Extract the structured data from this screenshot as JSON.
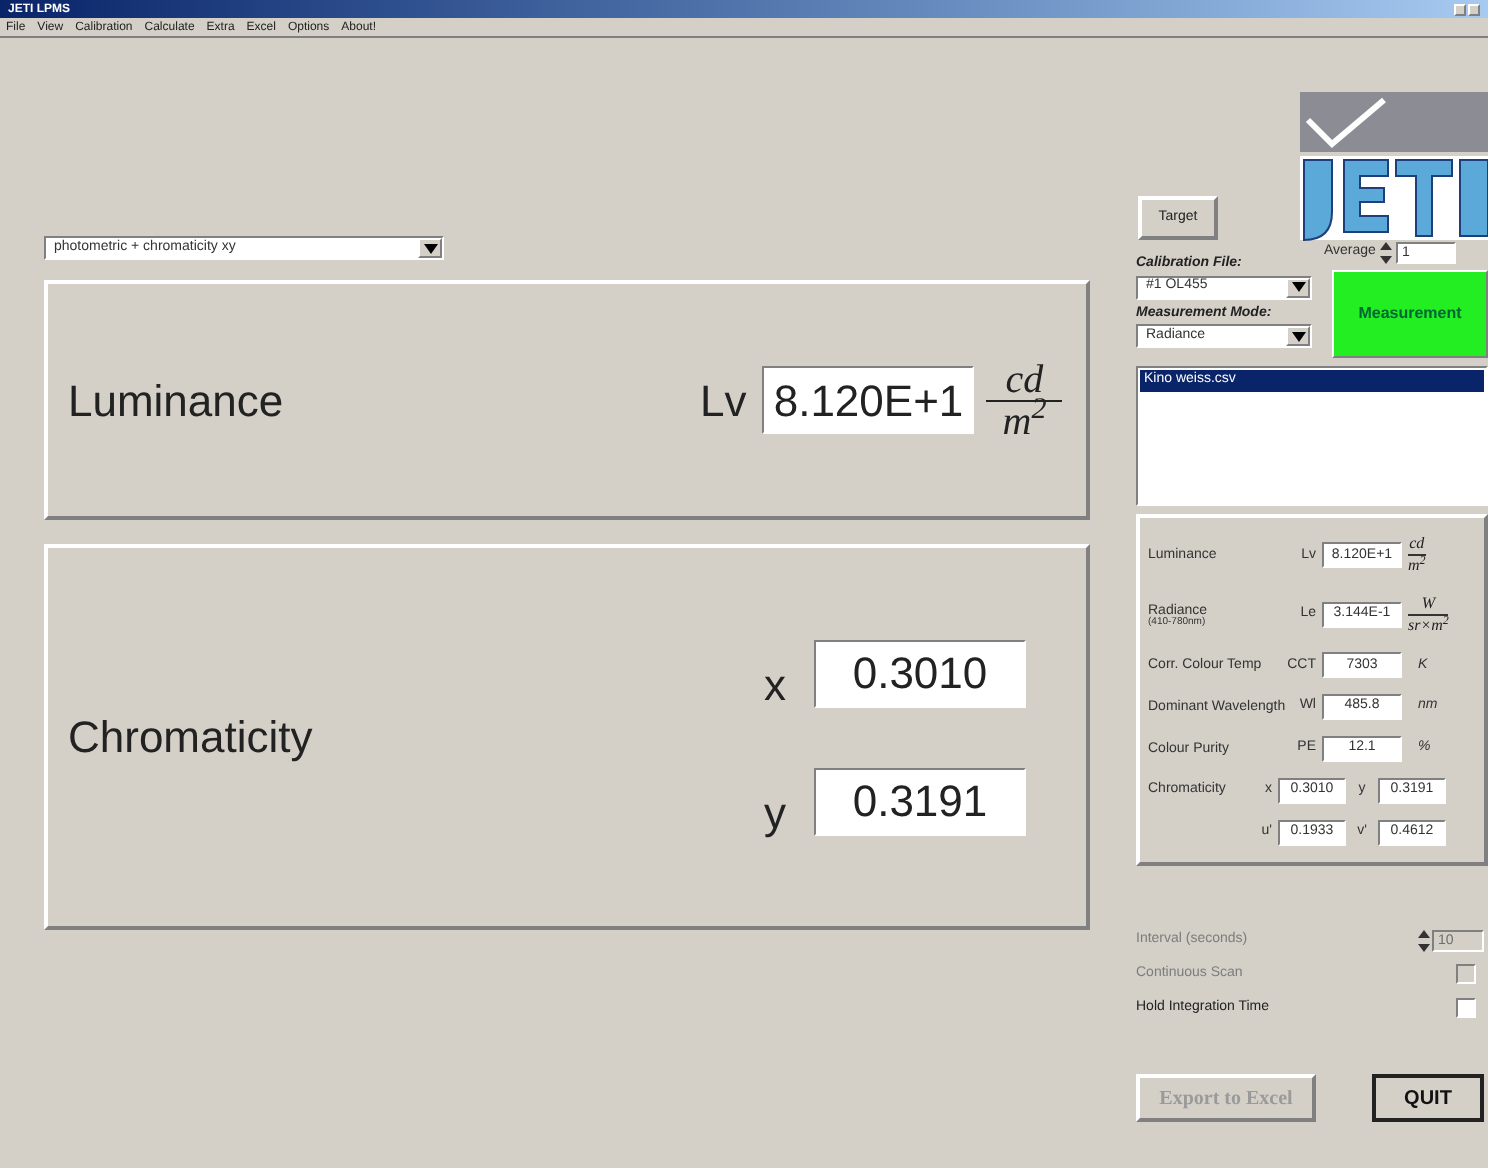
{
  "window": {
    "title": "JETI LPMS"
  },
  "menu": [
    "File",
    "View",
    "Calibration",
    "Calculate",
    "Extra",
    "Excel",
    "Options",
    "About!"
  ],
  "mode_select": {
    "value": "photometric + chromaticity xy"
  },
  "luminance_panel": {
    "title": "Luminance",
    "symbol": "Lv",
    "value": "8.120E+1",
    "unit_num": "cd",
    "unit_den": "m$^{2}$"
  },
  "chromaticity_panel": {
    "title": "Chromaticity",
    "rows": [
      {
        "symbol": "x",
        "value": "0.3010"
      },
      {
        "symbol": "y",
        "value": "0.3191"
      }
    ]
  },
  "target_button": "Target",
  "average": {
    "label": "Average",
    "value": "1"
  },
  "calibration_file": {
    "label": "Calibration File:",
    "value": "#1 OL455"
  },
  "measurement_mode": {
    "label": "Measurement Mode:",
    "value": "Radiance"
  },
  "measurement_button": "Measurement",
  "files": [
    {
      "name": "Kino weiss.csv",
      "selected": true
    }
  ],
  "results": [
    {
      "kind": "fraction",
      "label": "Luminance",
      "symbol": "Lv",
      "value": "8.120E+1",
      "unit_num": "cd",
      "unit_den": "m$^{2}$"
    },
    {
      "kind": "fraction",
      "label": "Radiance",
      "sublabel": "(410-780nm)",
      "symbol": "Le",
      "value": "3.144E-1",
      "unit_num": "W",
      "unit_den": "sr×m$^{2}$"
    },
    {
      "kind": "plain",
      "label": "Corr. Colour Temp",
      "symbol": "CCT",
      "value": "7303",
      "unit": "K"
    },
    {
      "kind": "plain",
      "label": "Dominant Wavelength",
      "symbol": "Wl",
      "value": "485.8",
      "unit": "nm"
    },
    {
      "kind": "plain",
      "label": "Colour Purity",
      "symbol": "PE",
      "value": "12.1",
      "unit": "%"
    },
    {
      "kind": "pair",
      "label": "Chromaticity",
      "symbol": "x",
      "value": "0.3010",
      "symbol2": "y",
      "value2": "0.3191"
    },
    {
      "kind": "pair",
      "symbol": "u'",
      "value": "0.1933",
      "symbol2": "v'",
      "value2": "0.4612"
    }
  ],
  "interval": {
    "label": "Interval (seconds)",
    "value": "10",
    "disabled": true
  },
  "options": [
    {
      "label": "Continuous Scan",
      "checked": false,
      "disabled": true
    },
    {
      "label": "Hold Integration Time",
      "checked": false,
      "disabled": false
    }
  ],
  "export_button": {
    "label": "Export to Excel",
    "disabled": true
  },
  "quit_button": "QUIT"
}
